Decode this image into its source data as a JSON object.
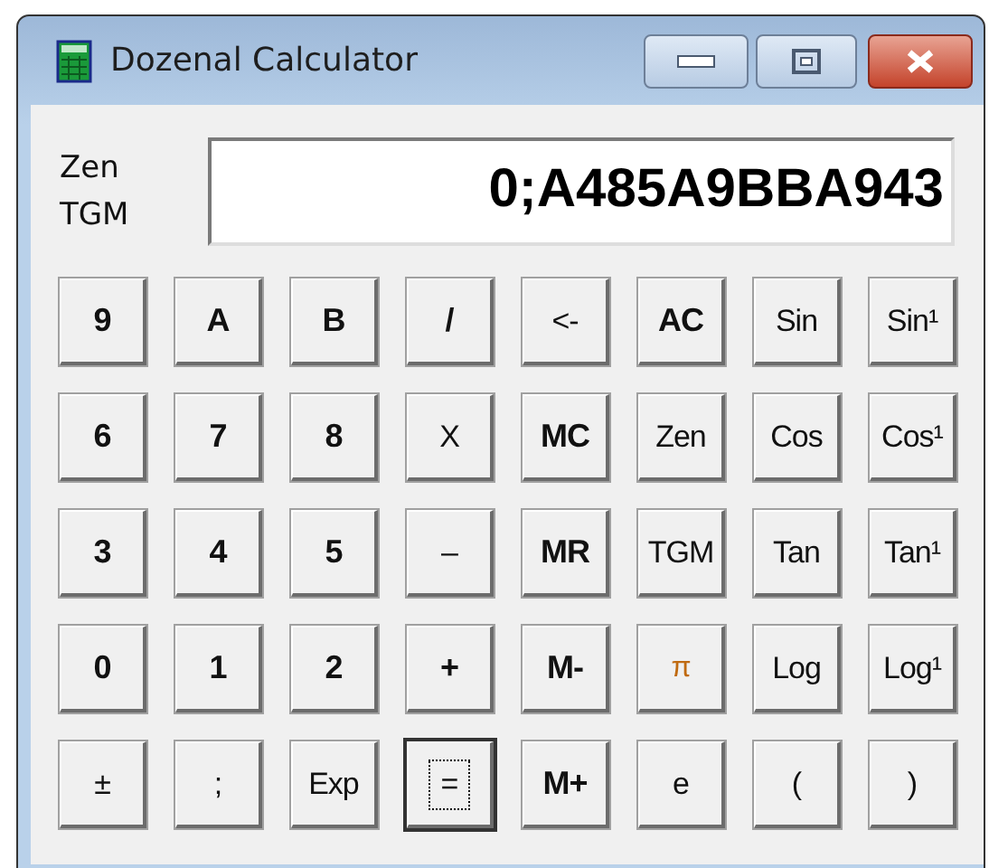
{
  "window": {
    "title": "Dozenal Calculator"
  },
  "mode_labels": [
    "Zen",
    "TGM"
  ],
  "display": {
    "value": "0;A485A9BBA943"
  },
  "buttons": [
    {
      "label": "9",
      "kind": "bold",
      "focused": false
    },
    {
      "label": "A",
      "kind": "bold",
      "focused": false
    },
    {
      "label": "B",
      "kind": "bold",
      "focused": false
    },
    {
      "label": "/",
      "kind": "bold",
      "focused": false
    },
    {
      "label": "<-",
      "kind": "plain",
      "focused": false
    },
    {
      "label": "AC",
      "kind": "bold",
      "focused": false
    },
    {
      "label": "Sin",
      "kind": "plain",
      "focused": false
    },
    {
      "label": "Sin¹",
      "kind": "plain",
      "focused": false
    },
    {
      "label": "6",
      "kind": "bold",
      "focused": false
    },
    {
      "label": "7",
      "kind": "bold",
      "focused": false
    },
    {
      "label": "8",
      "kind": "bold",
      "focused": false
    },
    {
      "label": "X",
      "kind": "plain",
      "focused": false
    },
    {
      "label": "MC",
      "kind": "bold",
      "focused": false
    },
    {
      "label": "Zen",
      "kind": "plain",
      "focused": false
    },
    {
      "label": "Cos",
      "kind": "plain",
      "focused": false
    },
    {
      "label": "Cos¹",
      "kind": "plain",
      "focused": false
    },
    {
      "label": "3",
      "kind": "bold",
      "focused": false
    },
    {
      "label": "4",
      "kind": "bold",
      "focused": false
    },
    {
      "label": "5",
      "kind": "bold",
      "focused": false
    },
    {
      "label": "–",
      "kind": "plain",
      "focused": false
    },
    {
      "label": "MR",
      "kind": "bold",
      "focused": false
    },
    {
      "label": "TGM",
      "kind": "plain",
      "focused": false
    },
    {
      "label": "Tan",
      "kind": "plain",
      "focused": false
    },
    {
      "label": "Tan¹",
      "kind": "plain",
      "focused": false
    },
    {
      "label": "0",
      "kind": "bold",
      "focused": false
    },
    {
      "label": "1",
      "kind": "bold",
      "focused": false
    },
    {
      "label": "2",
      "kind": "bold",
      "focused": false
    },
    {
      "label": "+",
      "kind": "bold",
      "focused": false
    },
    {
      "label": "M-",
      "kind": "bold",
      "focused": false
    },
    {
      "label": "π",
      "kind": "symbol",
      "focused": false
    },
    {
      "label": "Log",
      "kind": "plain",
      "focused": false
    },
    {
      "label": "Log¹",
      "kind": "plain",
      "focused": false
    },
    {
      "label": "±",
      "kind": "plain",
      "focused": false
    },
    {
      "label": ";",
      "kind": "plain",
      "focused": false
    },
    {
      "label": "Exp",
      "kind": "plain",
      "focused": false
    },
    {
      "label": "=",
      "kind": "plain",
      "focused": true
    },
    {
      "label": "M+",
      "kind": "bold",
      "focused": false
    },
    {
      "label": "e",
      "kind": "plain",
      "focused": false
    },
    {
      "label": "(",
      "kind": "plain",
      "focused": false
    },
    {
      "label": ")",
      "kind": "plain",
      "focused": false
    }
  ]
}
